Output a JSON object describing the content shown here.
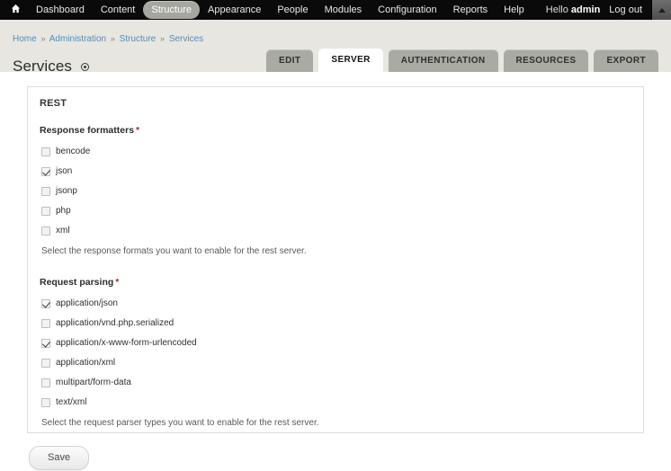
{
  "toolbar": {
    "home_icon": "home-icon",
    "items": [
      {
        "label": "Dashboard",
        "active": false
      },
      {
        "label": "Content",
        "active": false
      },
      {
        "label": "Structure",
        "active": true
      },
      {
        "label": "Appearance",
        "active": false
      },
      {
        "label": "People",
        "active": false
      },
      {
        "label": "Modules",
        "active": false
      },
      {
        "label": "Configuration",
        "active": false
      },
      {
        "label": "Reports",
        "active": false
      },
      {
        "label": "Help",
        "active": false
      }
    ],
    "greeting_prefix": "Hello ",
    "user_name": "admin",
    "logout_label": "Log out",
    "collapse_icon": "caret-up-icon"
  },
  "breadcrumb": {
    "items": [
      "Home",
      "Administration",
      "Structure",
      "Services"
    ],
    "separator": "»"
  },
  "page": {
    "title": "Services",
    "contextual_icon": "contextual-links-icon"
  },
  "tabs": [
    {
      "label": "EDIT",
      "active": false
    },
    {
      "label": "SERVER",
      "active": true
    },
    {
      "label": "AUTHENTICATION",
      "active": false
    },
    {
      "label": "RESOURCES",
      "active": false
    },
    {
      "label": "EXPORT",
      "active": false
    }
  ],
  "panel": {
    "title": "REST",
    "required_marker": "*",
    "response_formatters": {
      "label": "Response formatters",
      "options": [
        {
          "label": "bencode",
          "checked": false
        },
        {
          "label": "json",
          "checked": true
        },
        {
          "label": "jsonp",
          "checked": false
        },
        {
          "label": "php",
          "checked": false
        },
        {
          "label": "xml",
          "checked": false
        }
      ],
      "description": "Select the response formats you want to enable for the rest server."
    },
    "request_parsing": {
      "label": "Request parsing",
      "options": [
        {
          "label": "application/json",
          "checked": true
        },
        {
          "label": "application/vnd.php.serialized",
          "checked": false
        },
        {
          "label": "application/x-www-form-urlencoded",
          "checked": true
        },
        {
          "label": "application/xml",
          "checked": false
        },
        {
          "label": "multipart/form-data",
          "checked": false
        },
        {
          "label": "text/xml",
          "checked": false
        }
      ],
      "description": "Select the request parser types you want to enable for the rest server."
    }
  },
  "actions": {
    "save_label": "Save"
  },
  "colors": {
    "toolbar_bg": "#0a0a0a",
    "header_bg": "#e7e6e1",
    "tab_bg": "#aaaaa4",
    "tab_active_bg": "#ffffff",
    "link": "#4f8dc4",
    "required": "#c02525"
  }
}
